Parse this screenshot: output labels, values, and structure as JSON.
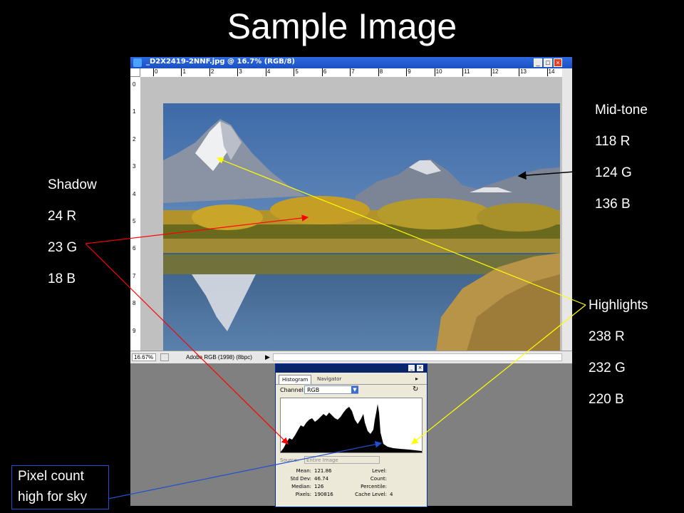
{
  "slide": {
    "title": "Sample Image"
  },
  "annotations": {
    "midtone": {
      "heading": "Mid-tone",
      "r": "118 R",
      "g": "124 G",
      "b": "136 B",
      "color": "#000000"
    },
    "shadow": {
      "heading": "Shadow",
      "r": "24 R",
      "g": "23 G",
      "b": "18 B",
      "color": "#ff0000"
    },
    "highlights": {
      "heading": "Highlights",
      "r": "238 R",
      "g": "232 G",
      "b": "220 B",
      "color": "#ffff00"
    },
    "pixel_count": {
      "line1": "Pixel count",
      "line2": "high for sky",
      "color": "#2050d0"
    }
  },
  "photoshop": {
    "window_title": "_D2X2419-2NNF.jpg @ 16.7% (RGB/8)",
    "ruler_top": [
      "0",
      "1",
      "2",
      "3",
      "4",
      "5",
      "6",
      "7",
      "8",
      "9",
      "10",
      "11",
      "12",
      "13",
      "14"
    ],
    "ruler_left": [
      "0",
      "1",
      "2",
      "3",
      "4",
      "5",
      "6",
      "7",
      "8",
      "9"
    ],
    "zoom": "16.67%",
    "profile": "Adobe RGB (1998) (8bpc)",
    "buttons": {
      "minimize": "_",
      "maximize": "□",
      "close": "×"
    }
  },
  "histogram_panel": {
    "tabs": [
      "Histogram",
      "Navigator"
    ],
    "channel_label": "Channel:",
    "channel_value": "RGB",
    "source_label": "Source:",
    "source_value": "Entire Image",
    "stats_left": [
      {
        "label": "Mean:",
        "value": "121.86"
      },
      {
        "label": "Std Dev:",
        "value": "46.74"
      },
      {
        "label": "Median:",
        "value": "126"
      },
      {
        "label": "Pixels:",
        "value": "190816"
      }
    ],
    "stats_right": [
      {
        "label": "Level:",
        "value": ""
      },
      {
        "label": "Count:",
        "value": ""
      },
      {
        "label": "Percentile:",
        "value": ""
      },
      {
        "label": "Cache Level:",
        "value": "4"
      }
    ]
  }
}
